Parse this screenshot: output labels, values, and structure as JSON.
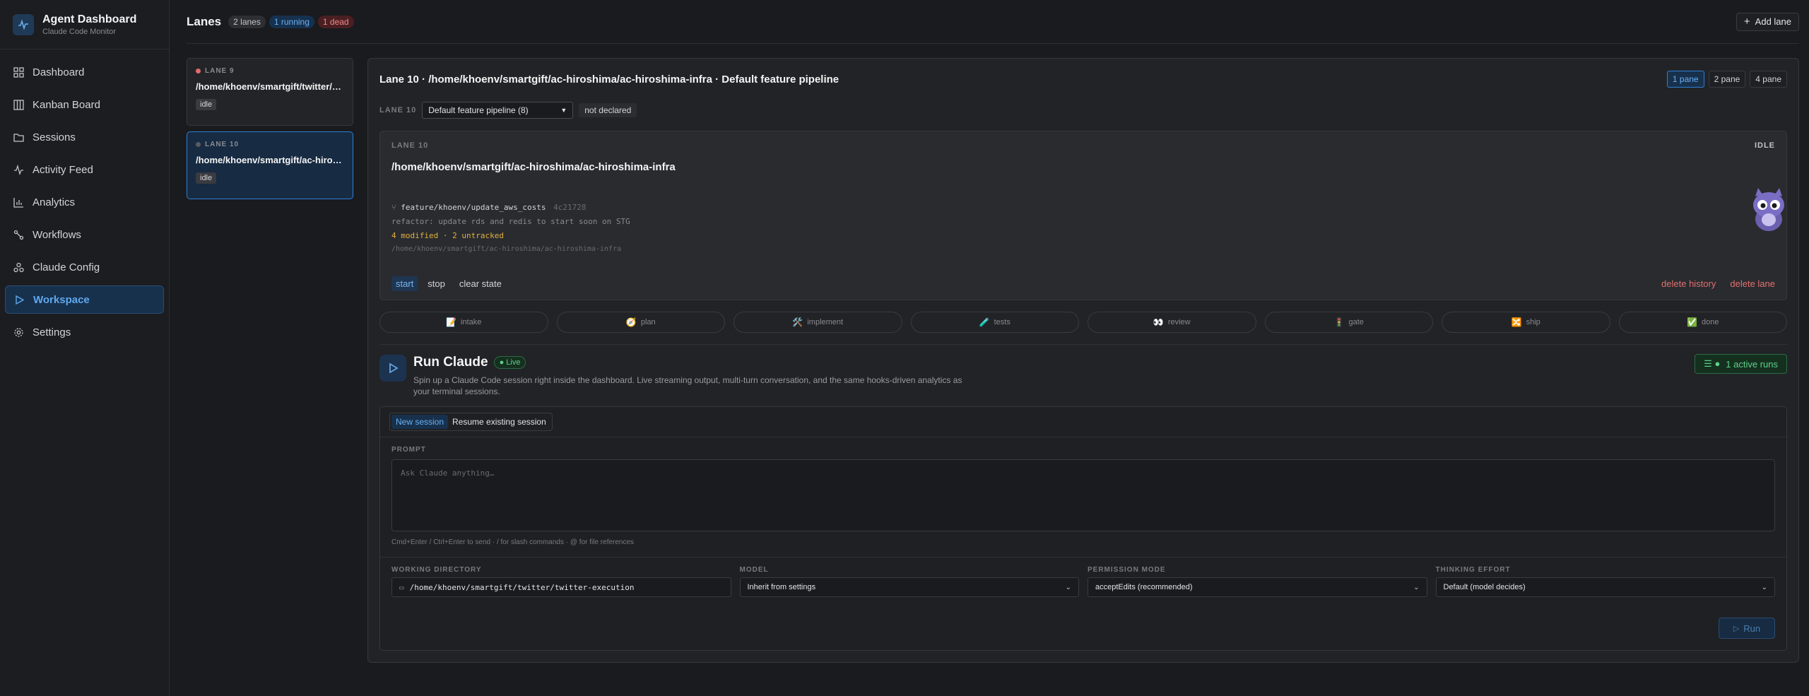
{
  "brand": {
    "title": "Agent Dashboard",
    "subtitle": "Claude Code Monitor"
  },
  "nav": [
    {
      "label": "Dashboard",
      "icon": "grid-icon"
    },
    {
      "label": "Kanban Board",
      "icon": "kanban-icon"
    },
    {
      "label": "Sessions",
      "icon": "folder-icon"
    },
    {
      "label": "Activity Feed",
      "icon": "activity-icon"
    },
    {
      "label": "Analytics",
      "icon": "chart-icon"
    },
    {
      "label": "Workflows",
      "icon": "workflow-icon"
    },
    {
      "label": "Claude Config",
      "icon": "config-icon"
    },
    {
      "label": "Workspace",
      "icon": "play-icon",
      "active": true
    },
    {
      "label": "Settings",
      "icon": "gear-icon"
    }
  ],
  "topbar": {
    "title": "Lanes",
    "lanes_count": "2 lanes",
    "running_count": "1 running",
    "dead_count": "1 dead",
    "add_lane": "Add lane"
  },
  "lanes": [
    {
      "label": "LANE 9",
      "path": "/home/khoenv/smartgift/twitter/twitter-execution",
      "state": "idle",
      "dot": "#e06b6b"
    },
    {
      "label": "LANE 10",
      "path": "/home/khoenv/smartgift/ac-hiroshima/ac-hiroshima-infra",
      "state": "idle",
      "dot": "#5a5b60"
    }
  ],
  "panel": {
    "title": "Lane 10 · /home/khoenv/smartgift/ac-hiroshima/ac-hiroshima-infra · Default feature pipeline",
    "panes": [
      "1 pane",
      "2 pane",
      "4 pane"
    ],
    "pipeline_label": "LANE 10",
    "pipeline_select": "Default feature pipeline (8)",
    "not_declared": "not declared"
  },
  "lane_box": {
    "label": "LANE 10",
    "status": "IDLE",
    "path": "/home/khoenv/smartgift/ac-hiroshima/ac-hiroshima-infra",
    "branch": "feature/khoenv/update_aws_costs",
    "commit": "4c21728",
    "message": "refactor: update rds and redis to start soon on STG",
    "changes": "4 modified · 2 untracked",
    "cwd": "/home/khoenv/smartgift/ac-hiroshima/ac-hiroshima-infra",
    "actions": {
      "start": "start",
      "stop": "stop",
      "clear": "clear state",
      "delete_history": "delete history",
      "delete_lane": "delete lane"
    }
  },
  "stages": [
    {
      "emoji": "📝",
      "label": "intake"
    },
    {
      "emoji": "🧭",
      "label": "plan"
    },
    {
      "emoji": "🛠️",
      "label": "implement"
    },
    {
      "emoji": "🧪",
      "label": "tests"
    },
    {
      "emoji": "👀",
      "label": "review"
    },
    {
      "emoji": "🚦",
      "label": "gate"
    },
    {
      "emoji": "🔀",
      "label": "ship"
    },
    {
      "emoji": "✅",
      "label": "done"
    }
  ],
  "run": {
    "title": "Run Claude",
    "live": "Live",
    "description": "Spin up a Claude Code session right inside the dashboard. Live streaming output, multi-turn conversation, and the same hooks-driven analytics as your terminal sessions.",
    "active_runs": "1 active runs",
    "tabs": [
      "New session",
      "Resume existing session"
    ],
    "prompt_label": "PROMPT",
    "prompt_placeholder": "Ask Claude anything…",
    "hint": "Cmd+Enter / Ctrl+Enter to send · / for slash commands · @ for file references",
    "fields": {
      "workdir_label": "WORKING DIRECTORY",
      "workdir_value": "/home/khoenv/smartgift/twitter/twitter-execution",
      "model_label": "MODEL",
      "model_value": "Inherit from settings",
      "perm_label": "PERMISSION MODE",
      "perm_value": "acceptEdits (recommended)",
      "effort_label": "THINKING EFFORT",
      "effort_value": "Default (model decides)"
    },
    "run_button": "Run"
  },
  "colors": {
    "accent": "#2f7fd6",
    "live": "#5fd08a",
    "danger": "#e0706f"
  }
}
